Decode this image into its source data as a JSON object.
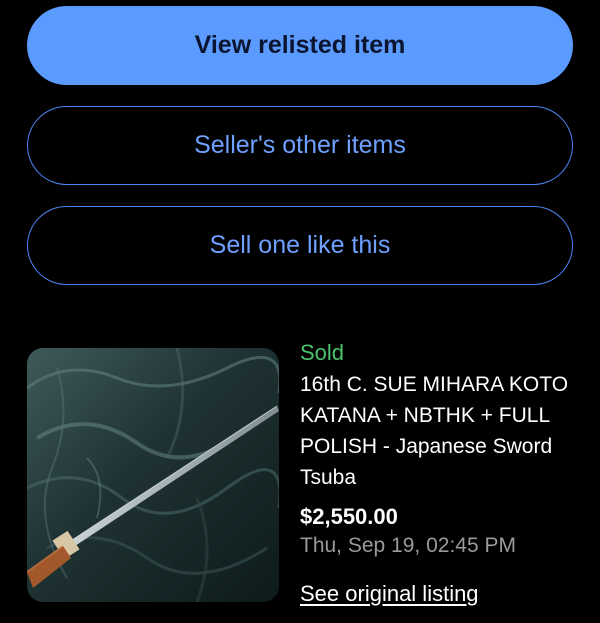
{
  "actions": {
    "view_relisted_label": "View relisted item",
    "seller_other_items_label": "Seller's other items",
    "sell_one_like_this_label": "Sell one like this"
  },
  "listing": {
    "status": "Sold",
    "title": "16th C. SUE MIHARA KOTO KATANA + NBTHK + FULL POLISH - Japanese Sword Tsuba",
    "price": "$2,550.00",
    "date": "Thu, Sep 19, 02:45 PM",
    "see_original_label": "See original listing",
    "image_alt": "Katana lying on dark teal satin fabric"
  },
  "colors": {
    "primary_button": "#5b9bff",
    "outline_border": "#4d86f5",
    "sold_green": "#4cc26e",
    "date_gray": "#9a9a9a",
    "background": "#000000"
  }
}
